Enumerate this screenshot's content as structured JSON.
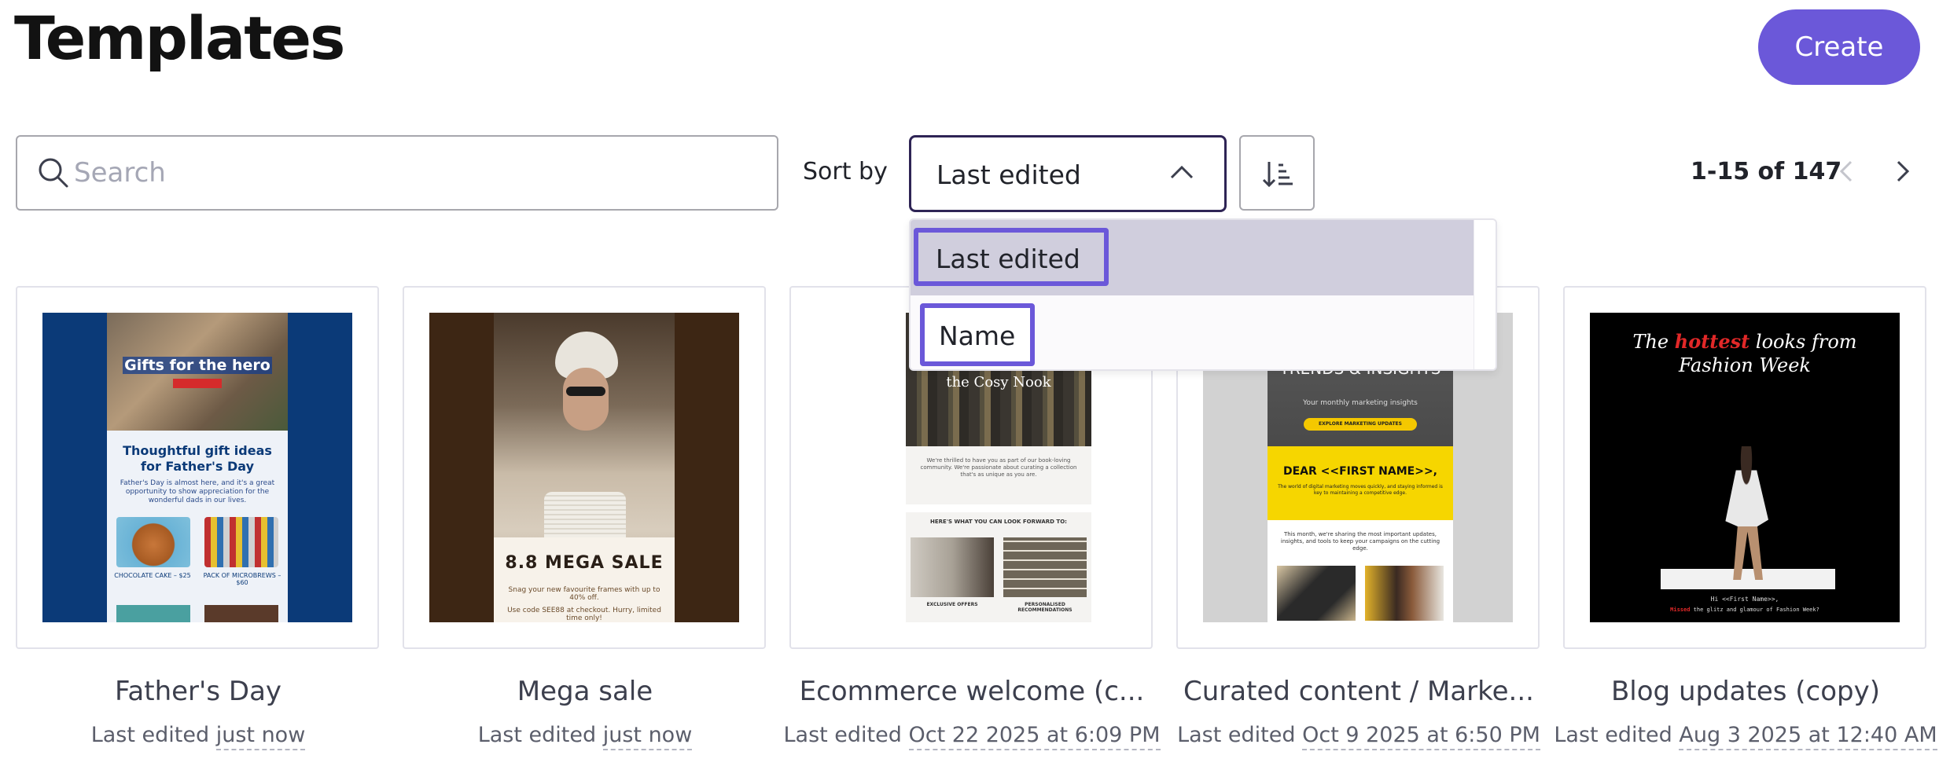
{
  "header": {
    "title": "Templates",
    "create_label": "Create"
  },
  "toolbar": {
    "search_placeholder": "Search",
    "search_value": "",
    "sort_label": "Sort by",
    "sort_value": "Last edited",
    "pagination_text": "1-15 of 147"
  },
  "sort_dropdown": {
    "options": [
      {
        "label": "Last edited",
        "selected": true
      },
      {
        "label": "Name",
        "selected": false
      }
    ]
  },
  "colors": {
    "accent": "#6b58d9",
    "select_border": "#2e2455",
    "selected_option_bg": "#d0cedd"
  },
  "templates": [
    {
      "name": "Father's Day",
      "meta_prefix": "Last edited",
      "meta_when": "just now",
      "thumb": {
        "banner": "Gifts for the hero",
        "heading": "Thoughtful gift ideas for Father's Day",
        "body": "Father's Day is almost here, and it's a great opportunity to show appreciation for the wonderful dads in our lives.",
        "item1": "CHOCOLATE CAKE – $25",
        "item2": "PACK OF MICROBREWS – $60"
      }
    },
    {
      "name": "Mega sale",
      "meta_prefix": "Last edited",
      "meta_when": "just now",
      "thumb": {
        "headline": "8.8 MEGA SALE",
        "sub": "Snag your new favourite frames with up to 40% off.",
        "sub2": "Use code SEE88 at checkout. Hurry, limited time only!"
      }
    },
    {
      "name": "Ecommerce welcome (c...",
      "meta_prefix": "Last edited",
      "meta_when": "Oct 22 2025 at 6:09 PM",
      "thumb": {
        "brand": "the Cosy Nook",
        "body": "We're thrilled to have you as part of our book-loving community. We're passionate about curating a collection that's as unique as you are.",
        "section": "HERE'S WHAT YOU CAN LOOK FORWARD TO:",
        "label1": "EXCLUSIVE OFFERS",
        "label2": "PERSONALISED RECOMMENDATIONS"
      }
    },
    {
      "name": "Curated content / Marke...",
      "meta_prefix": "Last edited",
      "meta_when": "Oct 9 2025 at 6:50 PM",
      "thumb": {
        "heading": "TRENDS & INSIGHTS",
        "sub": "Your monthly marketing insights",
        "cta": "EXPLORE MARKETING UPDATES",
        "dear": "DEAR <<FIRST NAME>>,",
        "yellow_text": "The world of digital marketing moves quickly, and staying informed is key to maintaining a competitive edge.",
        "body": "This month, we're sharing the most important updates, insights, and tools to keep your campaigns on the cutting edge."
      }
    },
    {
      "name": "Blog updates (copy)",
      "meta_prefix": "Last edited",
      "meta_when": "Aug 3 2025 at 12:40 AM",
      "thumb": {
        "title_a": "The ",
        "title_hot": "hottest",
        "title_b": " looks from Fashion Week",
        "greeting": "Hi <<First Name>>,",
        "line_red": "Missed",
        "line_rest": " the glitz and glamour of Fashion Week?"
      }
    }
  ]
}
